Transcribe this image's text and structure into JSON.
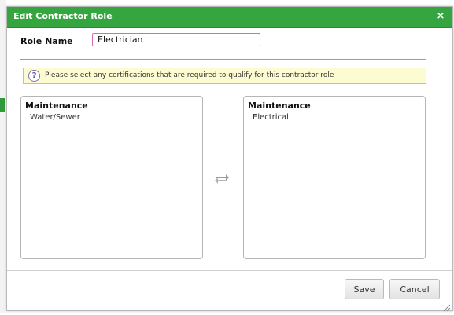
{
  "dialog": {
    "title": "Edit Contractor Role",
    "close_symbol": "×"
  },
  "role": {
    "label": "Role Name",
    "value": "Electrician"
  },
  "info": {
    "icon": "help-icon",
    "icon_glyph": "?",
    "text": "Please select any certifications that are required to qualify for this contractor role"
  },
  "available": {
    "group": "Maintenance",
    "items": [
      "Water/Sewer"
    ]
  },
  "selected": {
    "group": "Maintenance",
    "items": [
      "Electrical"
    ]
  },
  "transfer": {
    "icon": "swap-arrows-icon"
  },
  "buttons": {
    "save": "Save",
    "cancel": "Cancel"
  },
  "colors": {
    "titlebar": "#35a540",
    "input_focus_border": "#d66ab5",
    "info_background": "#fdfbd1"
  }
}
